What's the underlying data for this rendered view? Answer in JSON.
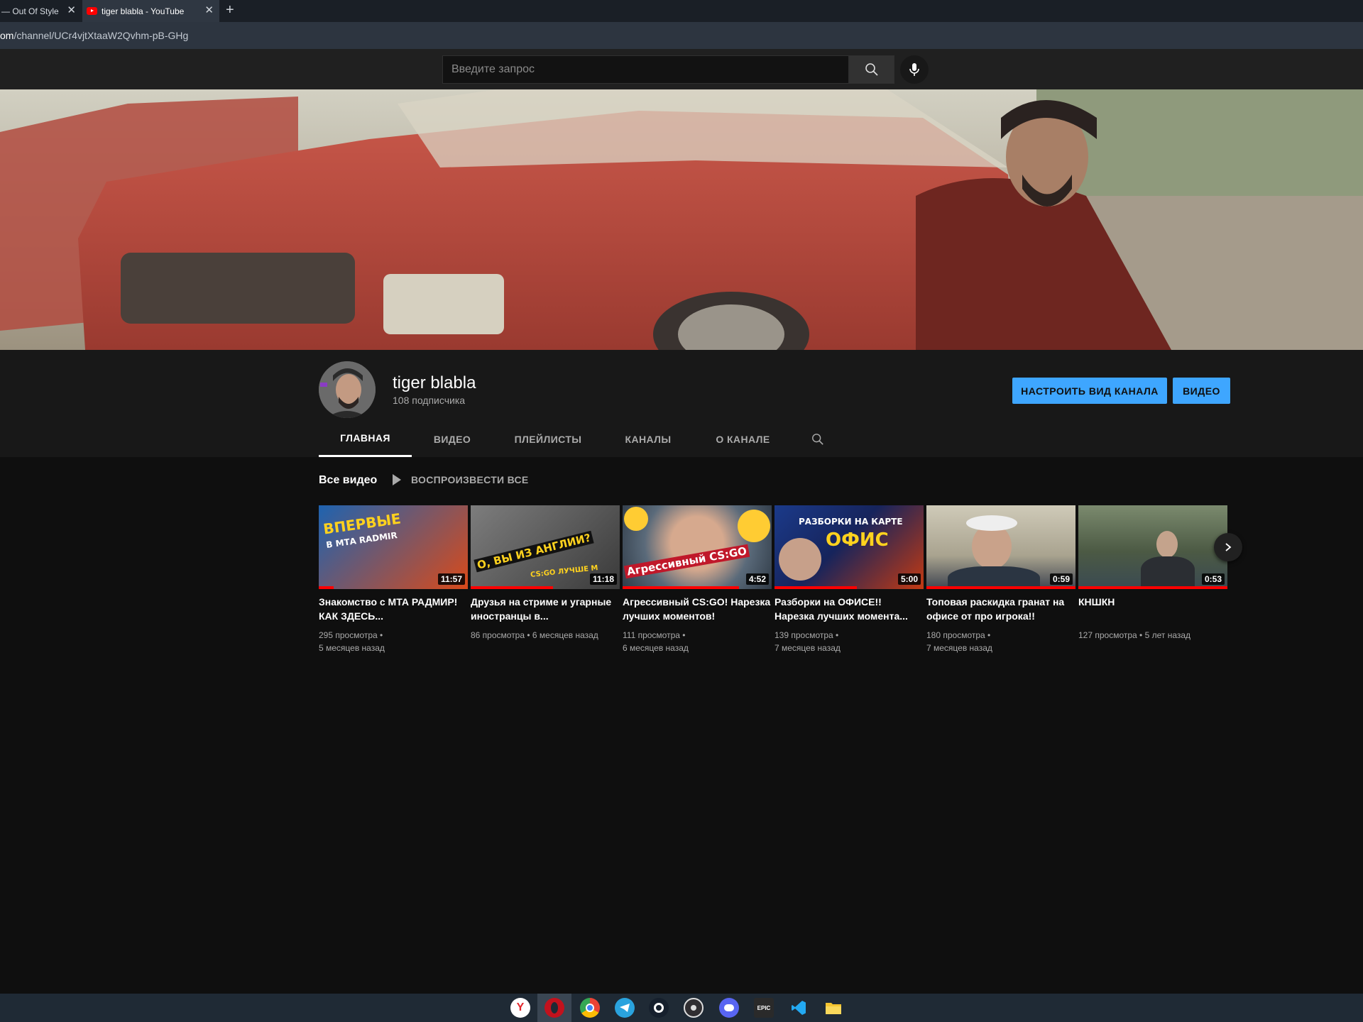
{
  "browser": {
    "tabs": [
      {
        "title": "— Out Of Style",
        "active": false
      },
      {
        "title": "tiger blabla - YouTube",
        "active": true
      }
    ],
    "close_glyph": "✕",
    "new_tab_glyph": "+",
    "url_domain": "om",
    "url_path": "/channel/UCr4vjtXtaaW2Qvhm-pB-GHg"
  },
  "header": {
    "search_placeholder": "Введите запрос"
  },
  "channel": {
    "name": "tiger blabla",
    "subscribers": "108 подписчика",
    "customize_label": "НАСТРОИТЬ ВИД КАНАЛА",
    "video_button_label": "ВИДЕО",
    "tabs": [
      "ГЛАВНАЯ",
      "ВИДЕО",
      "ПЛЕЙЛИСТЫ",
      "КАНАЛЫ",
      "О КАНАЛЕ"
    ],
    "active_tab": "ГЛАВНАЯ"
  },
  "shelf": {
    "title": "Все видео",
    "play_all": "ВОСПРОИЗВЕСТИ ВСЕ",
    "videos": [
      {
        "title": "Знакомство с МТА РАДМИР! КАК ЗДЕСЬ...",
        "duration": "11:57",
        "meta1": "295 просмотра •",
        "meta2": "5 месяцев назад",
        "watched": 0.1,
        "thumb_text1": "ВПЕРВЫЕ",
        "thumb_text2": "В МТА RADMIR"
      },
      {
        "title": "Друзья на стриме и угарные иностранцы в...",
        "duration": "11:18",
        "meta1": "86 просмотра • 6 месяцев назад",
        "meta2": "",
        "watched": 0.55,
        "thumb_text1": "О, ВЫ ИЗ АНГЛИИ?",
        "thumb_text2": "CS:GO ЛУЧШЕ М"
      },
      {
        "title": "Агрессивный CS:GO! Нарезка лучших моментов!",
        "duration": "4:52",
        "meta1": "111 просмотра •",
        "meta2": "6 месяцев назад",
        "watched": 0.78,
        "thumb_text1": "Агрессивный CS:GO",
        "thumb_text2": ""
      },
      {
        "title": "Разборки на ОФИСЕ!! Нарезка лучших момента...",
        "duration": "5:00",
        "meta1": "139 просмотра •",
        "meta2": "7 месяцев назад",
        "watched": 0.55,
        "thumb_text1": "РАЗБОРКИ НА КАРТЕ",
        "thumb_text2": "ОФИС"
      },
      {
        "title": "Топовая раскидка гранат на офисе от про игрока!!",
        "duration": "0:59",
        "meta1": "180 просмотра •",
        "meta2": "7 месяцев назад",
        "watched": 1.0,
        "thumb_text1": "",
        "thumb_text2": ""
      },
      {
        "title": "КНШКН",
        "duration": "0:53",
        "meta1": "127 просмотра • 5 лет назад",
        "meta2": "",
        "watched": 1.0,
        "thumb_text1": "",
        "thumb_text2": ""
      }
    ]
  },
  "taskbar": {
    "apps": [
      "yandex-browser",
      "opera",
      "chrome",
      "telegram",
      "steam",
      "obs",
      "discord",
      "epic-games",
      "vscode",
      "file-explorer"
    ],
    "active": "opera"
  },
  "colors": {
    "accent_blue": "#3ea6ff",
    "progress_red": "#ff0000",
    "page_bg": "#0f0f0f"
  }
}
